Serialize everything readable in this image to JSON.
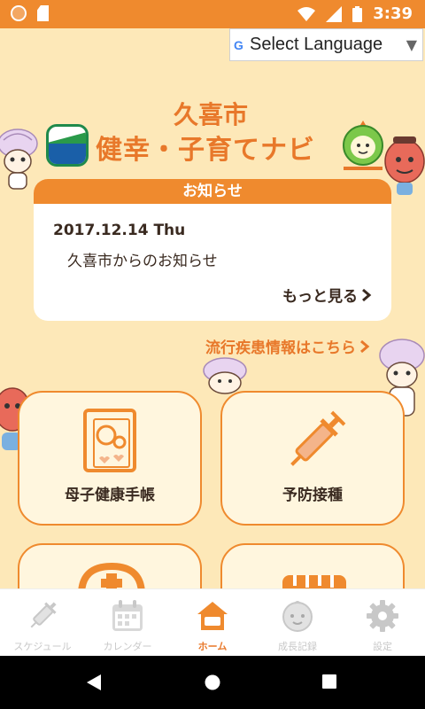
{
  "status_bar": {
    "time": "3:39",
    "icons": [
      "circle-icon",
      "sd-card-icon",
      "wifi-icon",
      "cell-signal-icon",
      "battery-icon"
    ]
  },
  "translate": {
    "g_letter": "G",
    "label": "Select Language",
    "arrow": "▼"
  },
  "header": {
    "city": "久喜市",
    "title": "健幸・子育てナビ"
  },
  "news": {
    "heading": "お知らせ",
    "date": "2017.12.14 Thu",
    "text": "久喜市からのお知らせ",
    "more_label": "もっと見る"
  },
  "disease_link": "流行疾患情報はこちら",
  "tiles": [
    {
      "label": "母子健康手帳",
      "icon": "mother-child-handbook-icon"
    },
    {
      "label": "予防接種",
      "icon": "syringe-icon"
    },
    {
      "label": "",
      "icon": "medical-kit-icon"
    },
    {
      "label": "",
      "icon": "ruler-icon"
    }
  ],
  "bottom_nav": [
    {
      "label": "スケジュール",
      "icon": "syringe-icon",
      "active": false
    },
    {
      "label": "カレンダー",
      "icon": "calendar-icon",
      "active": false
    },
    {
      "label": "ホーム",
      "icon": "home-icon",
      "active": true
    },
    {
      "label": "成長記録",
      "icon": "baby-face-icon",
      "active": false
    },
    {
      "label": "設定",
      "icon": "gear-icon",
      "active": false
    }
  ],
  "system_nav": [
    "back-icon",
    "home-circle-icon",
    "recents-icon"
  ],
  "colors": {
    "accent": "#ef8a2e",
    "background": "#fde8b8",
    "text": "#3a2a20",
    "inactive": "#c8c8c8"
  }
}
